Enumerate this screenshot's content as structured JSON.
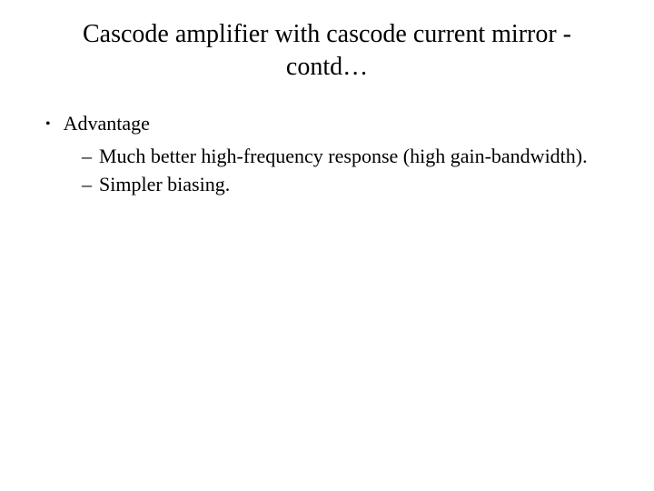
{
  "title": "Cascode amplifier with cascode current mirror - contd…",
  "bullet1": {
    "label": "Advantage",
    "sub1": "Much better high-frequency response (high gain-bandwidth).",
    "sub2": "Simpler biasing."
  }
}
